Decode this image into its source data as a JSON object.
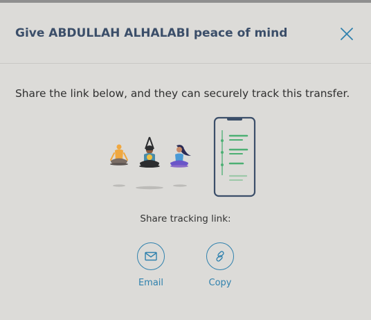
{
  "dialog": {
    "title": "Give ABDULLAH ALHALABI peace of mind",
    "close_icon": "close-icon"
  },
  "content": {
    "description": "Share the link below, and they can securely track this transfer.",
    "illustration": "meditating-people-and-phone-illustration"
  },
  "share": {
    "label": "Share tracking link:",
    "actions": [
      {
        "label": "Email",
        "icon": "envelope-icon"
      },
      {
        "label": "Copy",
        "icon": "link-icon"
      }
    ]
  },
  "colors": {
    "background": "#dcdbd8",
    "title": "#3b4e69",
    "accent": "#2f81ad",
    "phone_green": "#4caf73",
    "phone_frame": "#3b4e69"
  }
}
